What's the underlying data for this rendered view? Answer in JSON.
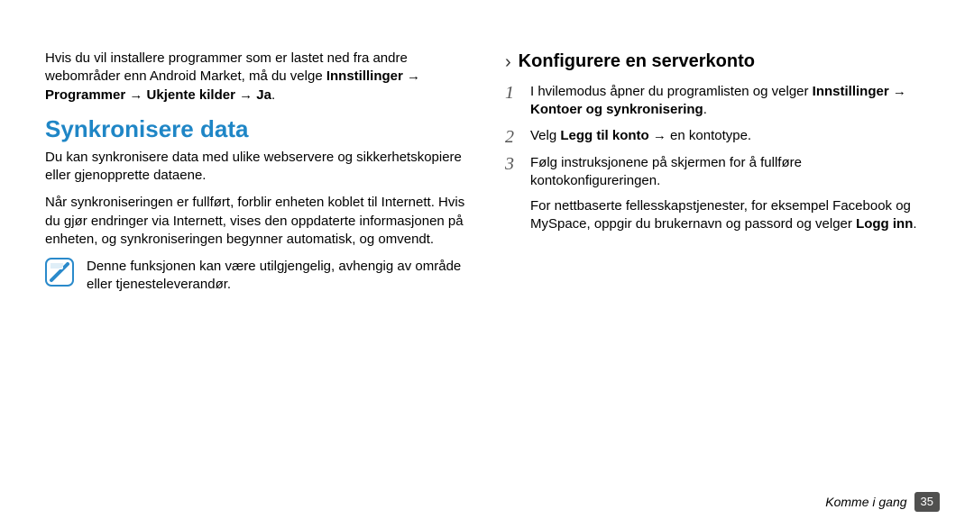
{
  "left": {
    "intro_pre": "Hvis du vil installere programmer som er lastet ned fra andre webområder enn Android Market, må du velge ",
    "intro_bold": "Innstillinger → Programmer → Ukjente kilder → Ja",
    "intro_post": ".",
    "heading": "Synkronisere data",
    "p1": "Du kan synkronisere data med ulike webservere og sikkerhetskopiere eller gjenopprette dataene.",
    "p2": "Når synkroniseringen er fullført, forblir enheten koblet til Internett. Hvis du gjør endringer via Internett, vises den oppdaterte informasjonen på enheten, og synkroniseringen begynner automatisk, og omvendt.",
    "note": "Denne funksjonen kan være utilgjengelig, avhengig av område eller tjenesteleverandør."
  },
  "right": {
    "chevron": "›",
    "sub_heading": "Konfigurere en serverkonto",
    "step1_marker": "1",
    "step1_pre": "I hvilemodus åpner du programlisten og velger ",
    "step1_bold": "Innstillinger → Kontoer og synkronisering",
    "step1_post": ".",
    "step2_marker": "2",
    "step2_pre": "Velg ",
    "step2_bold": "Legg til konto",
    "step2_post": " → en kontotype.",
    "step3_marker": "3",
    "step3_text": "Følg instruksjonene på skjermen for å fullføre kontokonfigureringen.",
    "step3_follow_pre": "For nettbaserte fellesskapstjenester, for eksempel Facebook og MySpace, oppgir du brukernavn og passord og velger ",
    "step3_follow_bold": "Logg inn",
    "step3_follow_post": "."
  },
  "footer": {
    "section": "Komme i gang",
    "page": "35"
  }
}
